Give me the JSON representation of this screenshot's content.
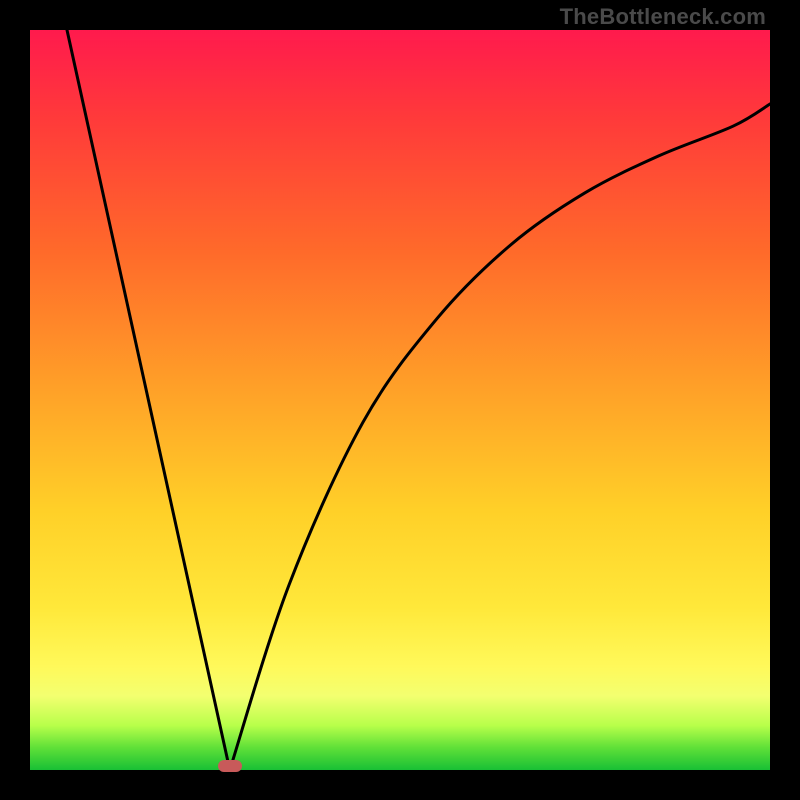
{
  "watermark": "TheBottleneck.com",
  "colors": {
    "frame": "#000000",
    "gradient_top": "#ff1a4d",
    "gradient_bottom": "#18c035",
    "curve_stroke": "#000000",
    "marker": "#c85a5a",
    "watermark_text": "#4a4a4a"
  },
  "chart_data": {
    "type": "line",
    "title": "",
    "xlabel": "",
    "ylabel": "",
    "xlim": [
      0,
      100
    ],
    "ylim": [
      0,
      100
    ],
    "grid": false,
    "legend": false,
    "note": "V-shaped bottleneck curve. Left branch: steep linear descent from (x≈5, y≈100) to valley at (x≈27, y≈0). Right branch: rising curve with decreasing slope from valley toward (x≈100, y≈90). Marker pill sits at valley floor.",
    "series": [
      {
        "name": "left_branch",
        "x": [
          5,
          16,
          27
        ],
        "y": [
          100,
          50,
          0
        ]
      },
      {
        "name": "right_branch",
        "x": [
          27,
          35,
          45,
          55,
          65,
          75,
          85,
          95,
          100
        ],
        "y": [
          0,
          25,
          47,
          61,
          71,
          78,
          83,
          87,
          90
        ]
      }
    ],
    "marker": {
      "x": 27,
      "y": 0,
      "shape": "pill"
    }
  }
}
